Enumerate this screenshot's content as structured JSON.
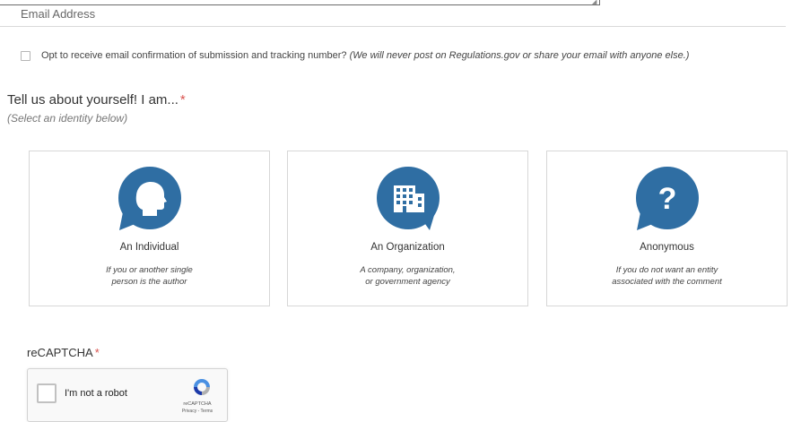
{
  "email": {
    "label": "Email Address"
  },
  "optin": {
    "text": "Opt to receive email confirmation of submission and tracking number?",
    "note": "(We will never post on Regulations.gov or share your email with anyone else.)"
  },
  "identity": {
    "heading": "Tell us about yourself! I am...",
    "required_mark": "*",
    "subheading": "(Select an identity below)",
    "cards": [
      {
        "title": "An Individual",
        "desc_line1": "If you or another single",
        "desc_line2": "person is the author",
        "icon": "person-head-icon"
      },
      {
        "title": "An Organization",
        "desc_line1": "A company, organization,",
        "desc_line2": "or government agency",
        "icon": "building-icon"
      },
      {
        "title": "Anonymous",
        "desc_line1": "If you do not want an entity",
        "desc_line2": "associated with the comment",
        "icon": "question-mark-icon"
      }
    ]
  },
  "recaptcha": {
    "label": "reCAPTCHA",
    "required_mark": "*",
    "checkbox_text": "I'm not a robot",
    "brand": "reCAPTCHA",
    "links": "Privacy - Terms"
  },
  "colors": {
    "icon_blue": "#2f6ea3",
    "required_red": "#d9534f"
  }
}
